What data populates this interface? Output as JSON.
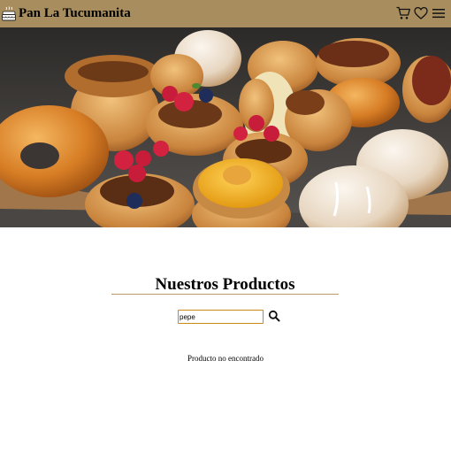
{
  "header": {
    "brand_name": "Pan La Tucumanita",
    "brand_icon": "cake-icon",
    "icons": [
      "cart-icon",
      "heart-icon",
      "menu-icon"
    ],
    "background_color": "#a88e5e"
  },
  "hero": {
    "image": "pastries-photo"
  },
  "products": {
    "title": "Nuestros Productos",
    "search": {
      "value": "pepe",
      "placeholder": ""
    },
    "search_icon": "search-icon",
    "empty_message": "Producto no encontrado"
  }
}
